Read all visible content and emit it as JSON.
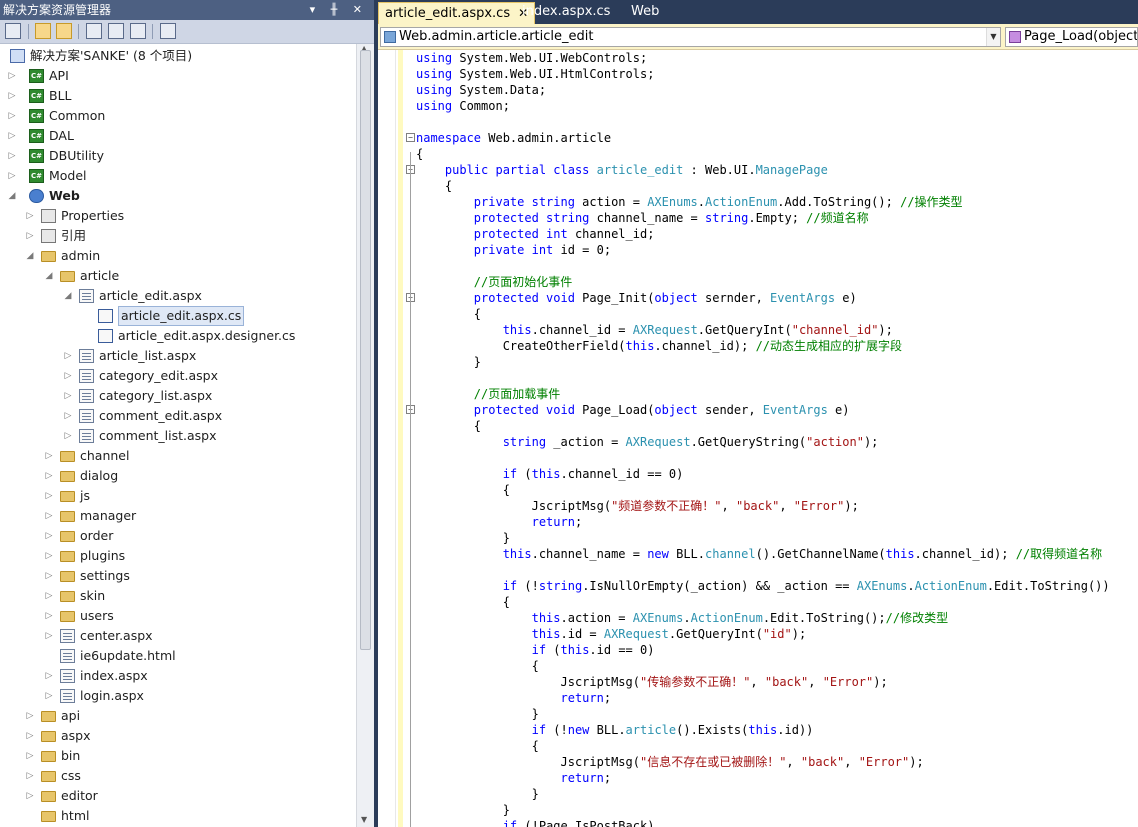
{
  "solution_explorer": {
    "title": "解决方案资源管理器",
    "title_buttons": "▾ ╫ ✕",
    "tree": [
      {
        "label": "解决方案'SANKE' (8 个项目)",
        "icon": "solution-icon",
        "depth": 0,
        "arrow": ""
      },
      {
        "label": "API",
        "icon": "csharp-project-icon",
        "depth": 0,
        "arrow": "▷"
      },
      {
        "label": "BLL",
        "icon": "csharp-project-icon",
        "depth": 0,
        "arrow": "▷"
      },
      {
        "label": "Common",
        "icon": "csharp-project-icon",
        "depth": 0,
        "arrow": "▷"
      },
      {
        "label": "DAL",
        "icon": "csharp-project-icon",
        "depth": 0,
        "arrow": "▷"
      },
      {
        "label": "DBUtility",
        "icon": "csharp-project-icon",
        "depth": 0,
        "arrow": "▷"
      },
      {
        "label": "Model",
        "icon": "csharp-project-icon",
        "depth": 0,
        "arrow": "▷"
      },
      {
        "label": "Web",
        "icon": "web-project-icon",
        "depth": 0,
        "arrow": "◢",
        "bold": true
      },
      {
        "label": "Properties",
        "icon": "properties-icon",
        "depth": 1,
        "arrow": "▷"
      },
      {
        "label": "引用",
        "icon": "references-icon",
        "depth": 1,
        "arrow": "▷"
      },
      {
        "label": "admin",
        "icon": "folder-open-icon",
        "depth": 1,
        "arrow": "◢"
      },
      {
        "label": "article",
        "icon": "folder-open-icon",
        "depth": 2,
        "arrow": "◢"
      },
      {
        "label": "article_edit.aspx",
        "icon": "aspx-page-icon",
        "depth": 3,
        "arrow": "◢"
      },
      {
        "label": "article_edit.aspx.cs",
        "icon": "cs-file-icon",
        "depth": 4,
        "arrow": "",
        "selected": true
      },
      {
        "label": "article_edit.aspx.designer.cs",
        "icon": "cs-file-icon",
        "depth": 4,
        "arrow": ""
      },
      {
        "label": "article_list.aspx",
        "icon": "aspx-page-icon",
        "depth": 3,
        "arrow": "▷"
      },
      {
        "label": "category_edit.aspx",
        "icon": "aspx-page-icon",
        "depth": 3,
        "arrow": "▷"
      },
      {
        "label": "category_list.aspx",
        "icon": "aspx-page-icon",
        "depth": 3,
        "arrow": "▷"
      },
      {
        "label": "comment_edit.aspx",
        "icon": "aspx-page-icon",
        "depth": 3,
        "arrow": "▷"
      },
      {
        "label": "comment_list.aspx",
        "icon": "aspx-page-icon",
        "depth": 3,
        "arrow": "▷"
      },
      {
        "label": "channel",
        "icon": "folder-icon",
        "depth": 2,
        "arrow": "▷"
      },
      {
        "label": "dialog",
        "icon": "folder-icon",
        "depth": 2,
        "arrow": "▷"
      },
      {
        "label": "js",
        "icon": "folder-icon",
        "depth": 2,
        "arrow": "▷"
      },
      {
        "label": "manager",
        "icon": "folder-icon",
        "depth": 2,
        "arrow": "▷"
      },
      {
        "label": "order",
        "icon": "folder-icon",
        "depth": 2,
        "arrow": "▷"
      },
      {
        "label": "plugins",
        "icon": "folder-icon",
        "depth": 2,
        "arrow": "▷"
      },
      {
        "label": "settings",
        "icon": "folder-icon",
        "depth": 2,
        "arrow": "▷"
      },
      {
        "label": "skin",
        "icon": "folder-icon",
        "depth": 2,
        "arrow": "▷"
      },
      {
        "label": "users",
        "icon": "folder-icon",
        "depth": 2,
        "arrow": "▷"
      },
      {
        "label": "center.aspx",
        "icon": "aspx-page-icon",
        "depth": 2,
        "arrow": "▷"
      },
      {
        "label": "ie6update.html",
        "icon": "html-file-icon",
        "depth": 2,
        "arrow": ""
      },
      {
        "label": "index.aspx",
        "icon": "aspx-page-icon",
        "depth": 2,
        "arrow": "▷"
      },
      {
        "label": "login.aspx",
        "icon": "aspx-page-icon",
        "depth": 2,
        "arrow": "▷"
      },
      {
        "label": "api",
        "icon": "folder-icon",
        "depth": 1,
        "arrow": "▷"
      },
      {
        "label": "aspx",
        "icon": "folder-icon",
        "depth": 1,
        "arrow": "▷"
      },
      {
        "label": "bin",
        "icon": "folder-icon",
        "depth": 1,
        "arrow": "▷"
      },
      {
        "label": "css",
        "icon": "folder-icon",
        "depth": 1,
        "arrow": "▷"
      },
      {
        "label": "editor",
        "icon": "folder-icon",
        "depth": 1,
        "arrow": "▷"
      },
      {
        "label": "html",
        "icon": "folder-icon",
        "depth": 1,
        "arrow": ""
      }
    ]
  },
  "editor": {
    "tabs": [
      {
        "label": "article_edit.aspx.cs",
        "active": true,
        "close": "✕"
      },
      {
        "label": "index.aspx.cs",
        "active": false
      },
      {
        "label": "Web",
        "active": false
      }
    ],
    "type_combo": "Web.admin.article.article_edit",
    "member_combo": "Page_Load(object se",
    "code_lines": [
      [
        [
          "using ",
          "kw"
        ],
        [
          "System.Web.UI.WebControls;",
          ""
        ]
      ],
      [
        [
          "using ",
          "kw"
        ],
        [
          "System.Web.UI.HtmlControls;",
          ""
        ]
      ],
      [
        [
          "using ",
          "kw"
        ],
        [
          "System.Data;",
          ""
        ]
      ],
      [
        [
          "using ",
          "kw"
        ],
        [
          "Common;",
          ""
        ]
      ],
      [],
      [
        [
          "namespace ",
          "kw"
        ],
        [
          "Web.admin.article",
          ""
        ]
      ],
      [
        [
          "{",
          ""
        ]
      ],
      [
        [
          "    ",
          ""
        ],
        [
          "public partial class ",
          "kw"
        ],
        [
          "article_edit",
          "ty"
        ],
        [
          " : Web.UI.",
          ""
        ],
        [
          "ManagePage",
          "ty"
        ]
      ],
      [
        [
          "    {",
          ""
        ]
      ],
      [
        [
          "        ",
          ""
        ],
        [
          "private string ",
          "kw"
        ],
        [
          "action = ",
          ""
        ],
        [
          "AXEnums",
          "ty"
        ],
        [
          ".",
          ""
        ],
        [
          "ActionEnum",
          "ty"
        ],
        [
          ".Add.ToString(); ",
          ""
        ],
        [
          "//操作类型",
          "cm"
        ]
      ],
      [
        [
          "        ",
          ""
        ],
        [
          "protected string ",
          "kw"
        ],
        [
          "channel_name = ",
          ""
        ],
        [
          "string",
          "kw"
        ],
        [
          ".Empty; ",
          ""
        ],
        [
          "//频道名称",
          "cm"
        ]
      ],
      [
        [
          "        ",
          ""
        ],
        [
          "protected int ",
          "kw"
        ],
        [
          "channel_id;",
          ""
        ]
      ],
      [
        [
          "        ",
          ""
        ],
        [
          "private int ",
          "kw"
        ],
        [
          "id = 0;",
          ""
        ]
      ],
      [],
      [
        [
          "        ",
          ""
        ],
        [
          "//页面初始化事件",
          "cm"
        ]
      ],
      [
        [
          "        ",
          ""
        ],
        [
          "protected void ",
          "kw"
        ],
        [
          "Page_Init(",
          ""
        ],
        [
          "object ",
          "kw"
        ],
        [
          "sernder, ",
          ""
        ],
        [
          "EventArgs",
          "ty"
        ],
        [
          " e)",
          ""
        ]
      ],
      [
        [
          "        {",
          ""
        ]
      ],
      [
        [
          "            ",
          ""
        ],
        [
          "this",
          "kw"
        ],
        [
          ".channel_id = ",
          ""
        ],
        [
          "AXRequest",
          "ty"
        ],
        [
          ".GetQueryInt(",
          ""
        ],
        [
          "\"channel_id\"",
          "st"
        ],
        [
          ");",
          ""
        ]
      ],
      [
        [
          "            CreateOtherField(",
          ""
        ],
        [
          "this",
          "kw"
        ],
        [
          ".channel_id); ",
          ""
        ],
        [
          "//动态生成相应的扩展字段",
          "cm"
        ]
      ],
      [
        [
          "        }",
          ""
        ]
      ],
      [],
      [
        [
          "        ",
          ""
        ],
        [
          "//页面加载事件",
          "cm"
        ]
      ],
      [
        [
          "        ",
          ""
        ],
        [
          "protected void ",
          "kw"
        ],
        [
          "Page_Load(",
          ""
        ],
        [
          "object ",
          "kw"
        ],
        [
          "sender, ",
          ""
        ],
        [
          "EventArgs",
          "ty"
        ],
        [
          " e)",
          ""
        ]
      ],
      [
        [
          "        {",
          ""
        ]
      ],
      [
        [
          "            ",
          ""
        ],
        [
          "string ",
          "kw"
        ],
        [
          "_action = ",
          ""
        ],
        [
          "AXRequest",
          "ty"
        ],
        [
          ".GetQueryString(",
          ""
        ],
        [
          "\"action\"",
          "st"
        ],
        [
          ");",
          ""
        ]
      ],
      [],
      [
        [
          "            ",
          ""
        ],
        [
          "if ",
          "kw"
        ],
        [
          "(",
          ""
        ],
        [
          "this",
          "kw"
        ],
        [
          ".channel_id == 0)",
          ""
        ]
      ],
      [
        [
          "            {",
          ""
        ]
      ],
      [
        [
          "                JscriptMsg(",
          ""
        ],
        [
          "\"频道参数不正确！\"",
          "st"
        ],
        [
          ", ",
          ""
        ],
        [
          "\"back\"",
          "st"
        ],
        [
          ", ",
          ""
        ],
        [
          "\"Error\"",
          "st"
        ],
        [
          ");",
          ""
        ]
      ],
      [
        [
          "                ",
          ""
        ],
        [
          "return",
          "kw"
        ],
        [
          ";",
          ""
        ]
      ],
      [
        [
          "            }",
          ""
        ]
      ],
      [
        [
          "            ",
          ""
        ],
        [
          "this",
          "kw"
        ],
        [
          ".channel_name = ",
          ""
        ],
        [
          "new ",
          "kw"
        ],
        [
          "BLL.",
          ""
        ],
        [
          "channel",
          "ty"
        ],
        [
          "().GetChannelName(",
          ""
        ],
        [
          "this",
          "kw"
        ],
        [
          ".channel_id); ",
          ""
        ],
        [
          "//取得频道名称",
          "cm"
        ]
      ],
      [],
      [
        [
          "            ",
          ""
        ],
        [
          "if ",
          "kw"
        ],
        [
          "(!",
          ""
        ],
        [
          "string",
          "kw"
        ],
        [
          ".IsNullOrEmpty(_action) && _action == ",
          ""
        ],
        [
          "AXEnums",
          "ty"
        ],
        [
          ".",
          ""
        ],
        [
          "ActionEnum",
          "ty"
        ],
        [
          ".Edit.ToString())",
          ""
        ]
      ],
      [
        [
          "            {",
          ""
        ]
      ],
      [
        [
          "                ",
          ""
        ],
        [
          "this",
          "kw"
        ],
        [
          ".action = ",
          ""
        ],
        [
          "AXEnums",
          "ty"
        ],
        [
          ".",
          ""
        ],
        [
          "ActionEnum",
          "ty"
        ],
        [
          ".Edit.ToString();",
          ""
        ],
        [
          "//修改类型",
          "cm"
        ]
      ],
      [
        [
          "                ",
          ""
        ],
        [
          "this",
          "kw"
        ],
        [
          ".id = ",
          ""
        ],
        [
          "AXRequest",
          "ty"
        ],
        [
          ".GetQueryInt(",
          ""
        ],
        [
          "\"id\"",
          "st"
        ],
        [
          ");",
          ""
        ]
      ],
      [
        [
          "                ",
          ""
        ],
        [
          "if ",
          "kw"
        ],
        [
          "(",
          ""
        ],
        [
          "this",
          "kw"
        ],
        [
          ".id == 0)",
          ""
        ]
      ],
      [
        [
          "                {",
          ""
        ]
      ],
      [
        [
          "                    JscriptMsg(",
          ""
        ],
        [
          "\"传输参数不正确！\"",
          "st"
        ],
        [
          ", ",
          ""
        ],
        [
          "\"back\"",
          "st"
        ],
        [
          ", ",
          ""
        ],
        [
          "\"Error\"",
          "st"
        ],
        [
          ");",
          ""
        ]
      ],
      [
        [
          "                    ",
          ""
        ],
        [
          "return",
          "kw"
        ],
        [
          ";",
          ""
        ]
      ],
      [
        [
          "                }",
          ""
        ]
      ],
      [
        [
          "                ",
          ""
        ],
        [
          "if ",
          "kw"
        ],
        [
          "(!",
          ""
        ],
        [
          "new ",
          "kw"
        ],
        [
          "BLL.",
          ""
        ],
        [
          "article",
          "ty"
        ],
        [
          "().Exists(",
          ""
        ],
        [
          "this",
          "kw"
        ],
        [
          ".id))",
          ""
        ]
      ],
      [
        [
          "                {",
          ""
        ]
      ],
      [
        [
          "                    JscriptMsg(",
          ""
        ],
        [
          "\"信息不存在或已被删除！\"",
          "st"
        ],
        [
          ", ",
          ""
        ],
        [
          "\"back\"",
          "st"
        ],
        [
          ", ",
          ""
        ],
        [
          "\"Error\"",
          "st"
        ],
        [
          ");",
          ""
        ]
      ],
      [
        [
          "                    ",
          ""
        ],
        [
          "return",
          "kw"
        ],
        [
          ";",
          ""
        ]
      ],
      [
        [
          "                }",
          ""
        ]
      ],
      [
        [
          "            }",
          ""
        ]
      ],
      [
        [
          "            ",
          ""
        ],
        [
          "if ",
          "kw"
        ],
        [
          "(!Page.IsPostBack)",
          ""
        ]
      ]
    ]
  },
  "colors": {
    "keyword": "#0000ff",
    "type": "#2b91af",
    "comment": "#008000",
    "string": "#a31515",
    "title_bar": "#4d6082",
    "tab_active": "#fcf4c8"
  }
}
